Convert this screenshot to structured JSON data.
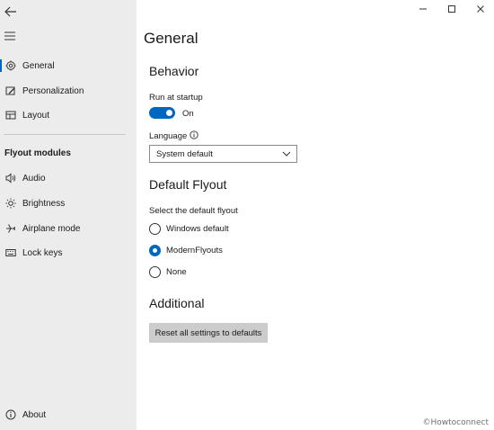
{
  "window": {
    "controls": [
      "minimize",
      "maximize",
      "close"
    ]
  },
  "sidebar": {
    "top_items": [
      {
        "label": "General",
        "icon": "gear-icon",
        "active": true
      },
      {
        "label": "Personalization",
        "icon": "paint-icon",
        "active": false
      },
      {
        "label": "Layout",
        "icon": "layout-icon",
        "active": false
      }
    ],
    "section_title": "Flyout modules",
    "module_items": [
      {
        "label": "Audio",
        "icon": "audio-icon"
      },
      {
        "label": "Brightness",
        "icon": "brightness-icon"
      },
      {
        "label": "Airplane mode",
        "icon": "airplane-icon"
      },
      {
        "label": "Lock keys",
        "icon": "keyboard-icon"
      }
    ],
    "about": {
      "label": "About",
      "icon": "info-icon"
    }
  },
  "main": {
    "title": "General",
    "behavior": {
      "heading": "Behavior",
      "startup_label": "Run at startup",
      "startup_state": "On",
      "startup_on": true,
      "language_label": "Language",
      "language_value": "System default"
    },
    "default_flyout": {
      "heading": "Default Flyout",
      "prompt": "Select the default flyout",
      "options": [
        {
          "label": "Windows default",
          "checked": false
        },
        {
          "label": "ModernFlyouts",
          "checked": true
        },
        {
          "label": "None",
          "checked": false
        }
      ]
    },
    "additional": {
      "heading": "Additional",
      "reset_label": "Reset all settings to defaults"
    }
  },
  "watermark": "©Howtoconnect",
  "colors": {
    "accent": "#0067c0",
    "sidebar_bg": "#ececec",
    "button_bg": "#cccccc"
  }
}
